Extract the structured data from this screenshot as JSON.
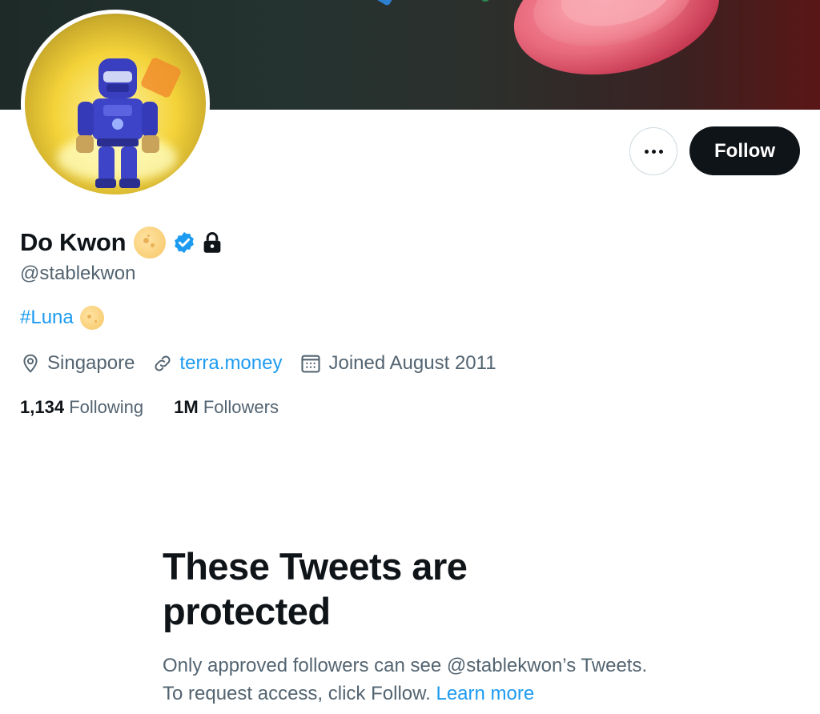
{
  "profile": {
    "display_name": "Do Kwon",
    "handle": "@stablekwon",
    "bio_hashtag": "#Luna",
    "location": "Singapore",
    "website": "terra.money",
    "joined": "Joined August 2011",
    "following_count": "1,134",
    "following_label": "Following",
    "followers_count": "1M",
    "followers_label": "Followers"
  },
  "actions": {
    "follow_label": "Follow"
  },
  "protected": {
    "title": "These Tweets are protected",
    "description": "Only approved followers can see @stablekwon’s Tweets. To request access, click Follow.",
    "learn_more": "Learn more"
  },
  "icons": {
    "more": "more-options-icon",
    "verified": "verified-badge-icon",
    "lock": "lock-icon",
    "location": "location-pin-icon",
    "link": "link-icon",
    "calendar": "calendar-icon",
    "moon": "moon-emoji-icon"
  },
  "colors": {
    "accent": "#1d9bf0",
    "text_primary": "#0f1419",
    "text_secondary": "#536471",
    "follow_bg": "#0f1419"
  }
}
